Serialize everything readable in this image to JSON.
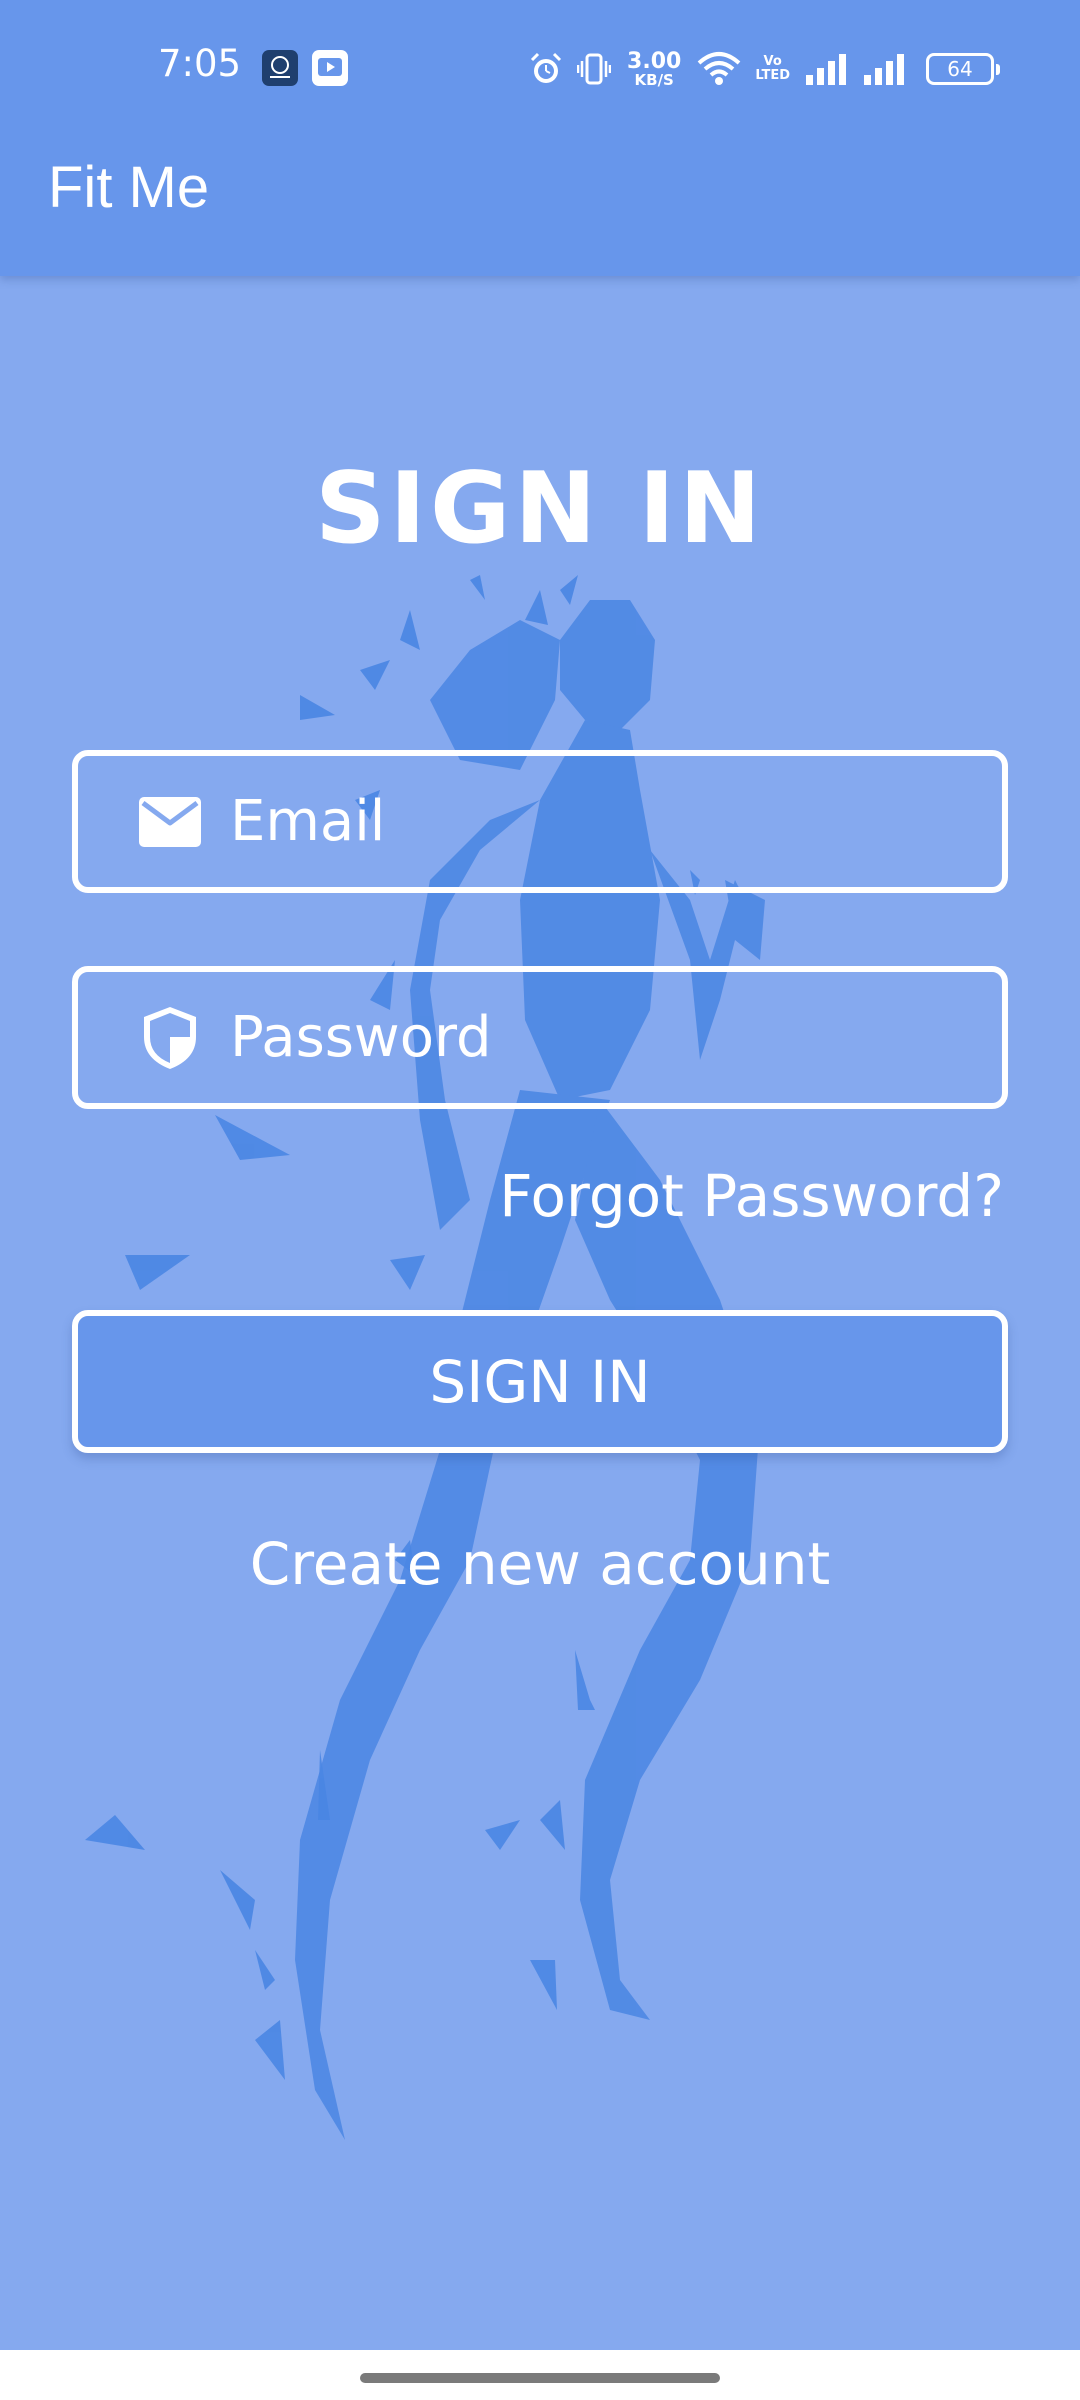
{
  "status_bar": {
    "time": "7:05",
    "net_speed_value": "3.00",
    "net_speed_unit": "KB/S",
    "volte_line1": "Vo",
    "volte_line2": "LTED",
    "battery": "64",
    "icons": [
      "app-notification-icon",
      "youtube-notification-icon",
      "alarm-icon",
      "vibrate-icon",
      "wifi-icon",
      "signal-icon",
      "signal-icon",
      "battery-icon"
    ]
  },
  "app_bar": {
    "title": "Fit Me"
  },
  "form": {
    "heading": "SIGN IN",
    "email_placeholder": "Email",
    "email_value": "",
    "password_placeholder": "Password",
    "password_value": "",
    "forgot_password": "Forgot Password?",
    "signin_button": "SIGN IN",
    "create_account": "Create new account"
  },
  "colors": {
    "app_bar": "#6796eb",
    "background": "#85a9ef",
    "button": "#6796eb",
    "figure": "#4a86e3",
    "text": "#ffffff"
  }
}
